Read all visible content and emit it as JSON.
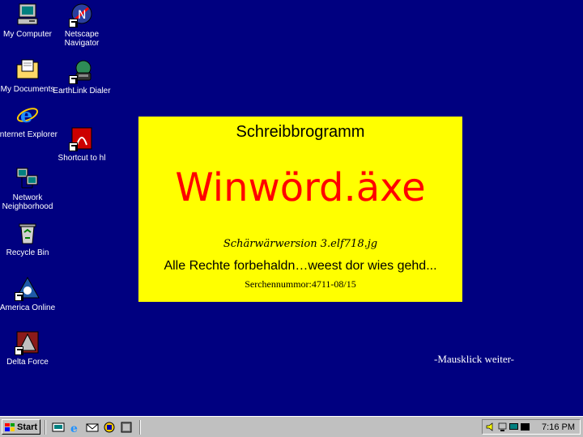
{
  "desktop": {
    "icons": [
      {
        "label": "My Computer"
      },
      {
        "label": "Netscape Navigator"
      },
      {
        "label": "My Documents"
      },
      {
        "label": "EarthLink Dialer"
      },
      {
        "label": "Internet Explorer"
      },
      {
        "label": "Shortcut to hl"
      },
      {
        "label": "Network Neighborhood"
      },
      {
        "label": "Recycle Bin"
      },
      {
        "label": "America Online"
      },
      {
        "label": "Delta Force"
      }
    ]
  },
  "splash": {
    "subtitle": "Schreibbrogramm",
    "title": "Winwörd.äxe",
    "version": "Schärwärwersion 3.elf718.jg",
    "rights": "Alle Rechte forbehaldn…weest dor wies gehd...",
    "serial": "Serchennummor:4711-08/15",
    "colors": {
      "background": "#ffff00",
      "title": "#ff0000"
    }
  },
  "hint": "-Mausklick weiter-",
  "taskbar": {
    "start_label": "Start",
    "clock": "7:16 PM"
  },
  "colors": {
    "desktop": "#000080",
    "taskbar": "#c0c0c0"
  }
}
